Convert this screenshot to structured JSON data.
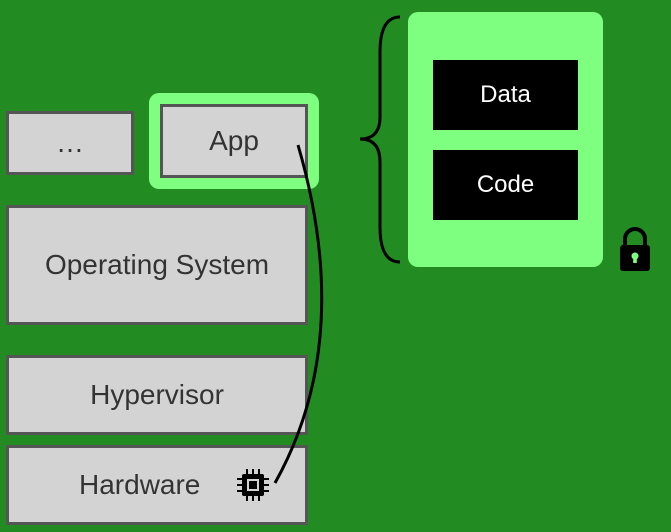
{
  "stack": {
    "ellipsis": "…",
    "app": "App",
    "os": "Operating System",
    "hypervisor": "Hypervisor",
    "hardware": "Hardware"
  },
  "enclave": {
    "data": "Data",
    "code": "Code"
  },
  "icons": {
    "lock": "lock-icon",
    "chip": "chip-icon"
  },
  "colors": {
    "background": "#228B22",
    "box_fill": "#d3d3d3",
    "box_border": "#555555",
    "highlight": "#7FFF7F",
    "enclave_box": "#000000",
    "enclave_text": "#ffffff"
  }
}
